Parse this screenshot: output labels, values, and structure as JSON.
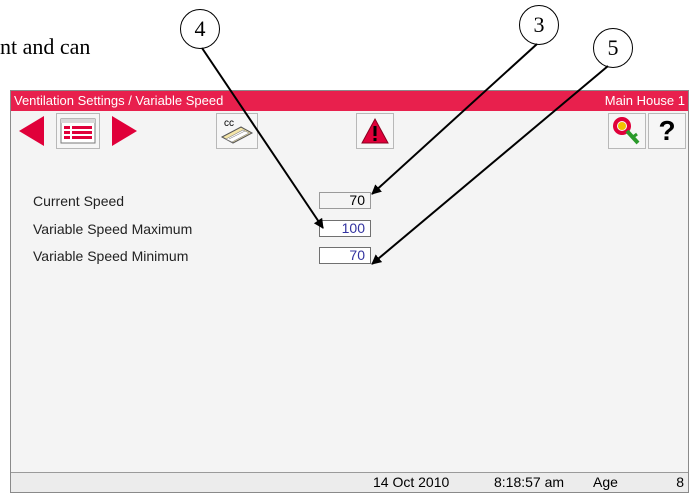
{
  "document": {
    "text_fragment": "nt and can"
  },
  "callouts": [
    "4",
    "3",
    "5"
  ],
  "titlebar": {
    "title": "Ventilation Settings / Variable Speed",
    "location": "Main House 1"
  },
  "toolbar": {
    "icons": [
      "arrow-left-icon",
      "list-icon",
      "arrow-right-icon",
      "copy-icon",
      "warning-icon",
      "key-icon",
      "help-icon"
    ],
    "copy_label": "cc",
    "help_label": "?"
  },
  "fields": [
    {
      "label": "Current Speed",
      "value": "70"
    },
    {
      "label": "Variable Speed Maximum",
      "value": "100"
    },
    {
      "label": "Variable Speed Minimum",
      "value": "70"
    }
  ],
  "status": {
    "date": "14 Oct 2010",
    "time": "8:18:57 am",
    "age_label": "Age",
    "age_value": "8"
  },
  "colors": {
    "title_bar": "#e8204d",
    "nav_arrow": "#e0003a",
    "editable_value": "#3333a0"
  }
}
